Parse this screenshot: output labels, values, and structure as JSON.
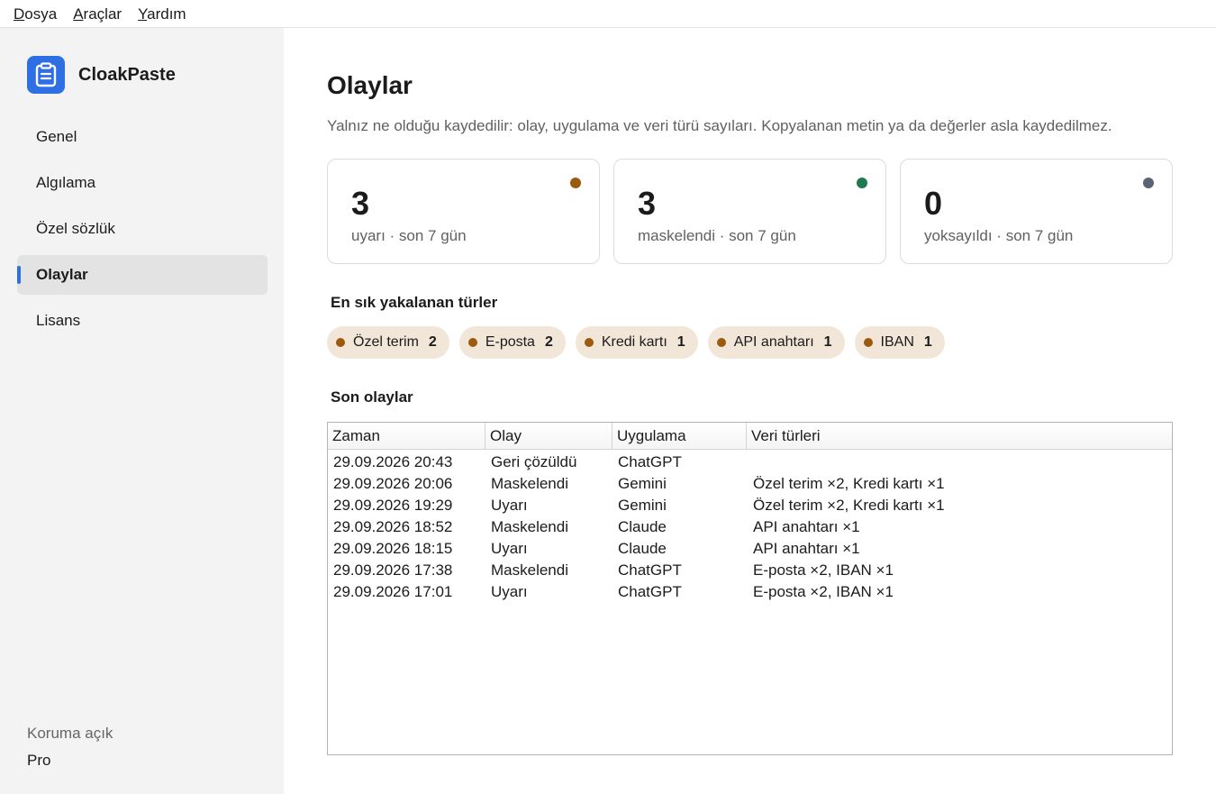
{
  "menu": [
    {
      "mnemonic": "D",
      "rest": "osya"
    },
    {
      "mnemonic": "A",
      "rest": "raçlar"
    },
    {
      "mnemonic": "Y",
      "rest": "ardım"
    }
  ],
  "brand": {
    "name": "CloakPaste",
    "icon": "clipboard-icon",
    "color": "#2f6fe4"
  },
  "sidebar": {
    "items": [
      {
        "label": "Genel",
        "active": false
      },
      {
        "label": "Algılama",
        "active": false
      },
      {
        "label": "Özel sözlük",
        "active": false
      },
      {
        "label": "Olaylar",
        "active": true
      },
      {
        "label": "Lisans",
        "active": false
      }
    ],
    "status": "Koruma açık",
    "plan": "Pro"
  },
  "main": {
    "title": "Olaylar",
    "description": "Yalnız ne olduğu kaydedilir: olay, uygulama ve veri türü sayıları. Kopyalanan metin ya da değerler asla kaydedilmez.",
    "stats": [
      {
        "value": "3",
        "label": "uyarı · son 7 gün",
        "dot_color": "#9c5a0e"
      },
      {
        "value": "3",
        "label": "maskelendi · son 7 gün",
        "dot_color": "#1f7a4f"
      },
      {
        "value": "0",
        "label": "yoksayıldı · son 7 gün",
        "dot_color": "#5b6474"
      }
    ],
    "top_types_title": "En sık yakalanan türler",
    "top_types": [
      {
        "label": "Özel terim",
        "count": "2"
      },
      {
        "label": "E-posta",
        "count": "2"
      },
      {
        "label": "Kredi kartı",
        "count": "1"
      },
      {
        "label": "API anahtarı",
        "count": "1"
      },
      {
        "label": "IBAN",
        "count": "1"
      }
    ],
    "recent_title": "Son olaylar",
    "table": {
      "columns": [
        "Zaman",
        "Olay",
        "Uygulama",
        "Veri türleri"
      ],
      "rows": [
        [
          "29.09.2026 20:43",
          "Geri çözüldü",
          "ChatGPT",
          ""
        ],
        [
          "29.09.2026 20:06",
          "Maskelendi",
          "Gemini",
          "Özel terim ×2, Kredi kartı ×1"
        ],
        [
          "29.09.2026 19:29",
          "Uyarı",
          "Gemini",
          "Özel terim ×2, Kredi kartı ×1"
        ],
        [
          "29.09.2026 18:52",
          "Maskelendi",
          "Claude",
          "API anahtarı ×1"
        ],
        [
          "29.09.2026 18:15",
          "Uyarı",
          "Claude",
          "API anahtarı ×1"
        ],
        [
          "29.09.2026 17:38",
          "Maskelendi",
          "ChatGPT",
          "E-posta ×2, IBAN ×1"
        ],
        [
          "29.09.2026 17:01",
          "Uyarı",
          "ChatGPT",
          "E-posta ×2, IBAN ×1"
        ]
      ]
    }
  }
}
